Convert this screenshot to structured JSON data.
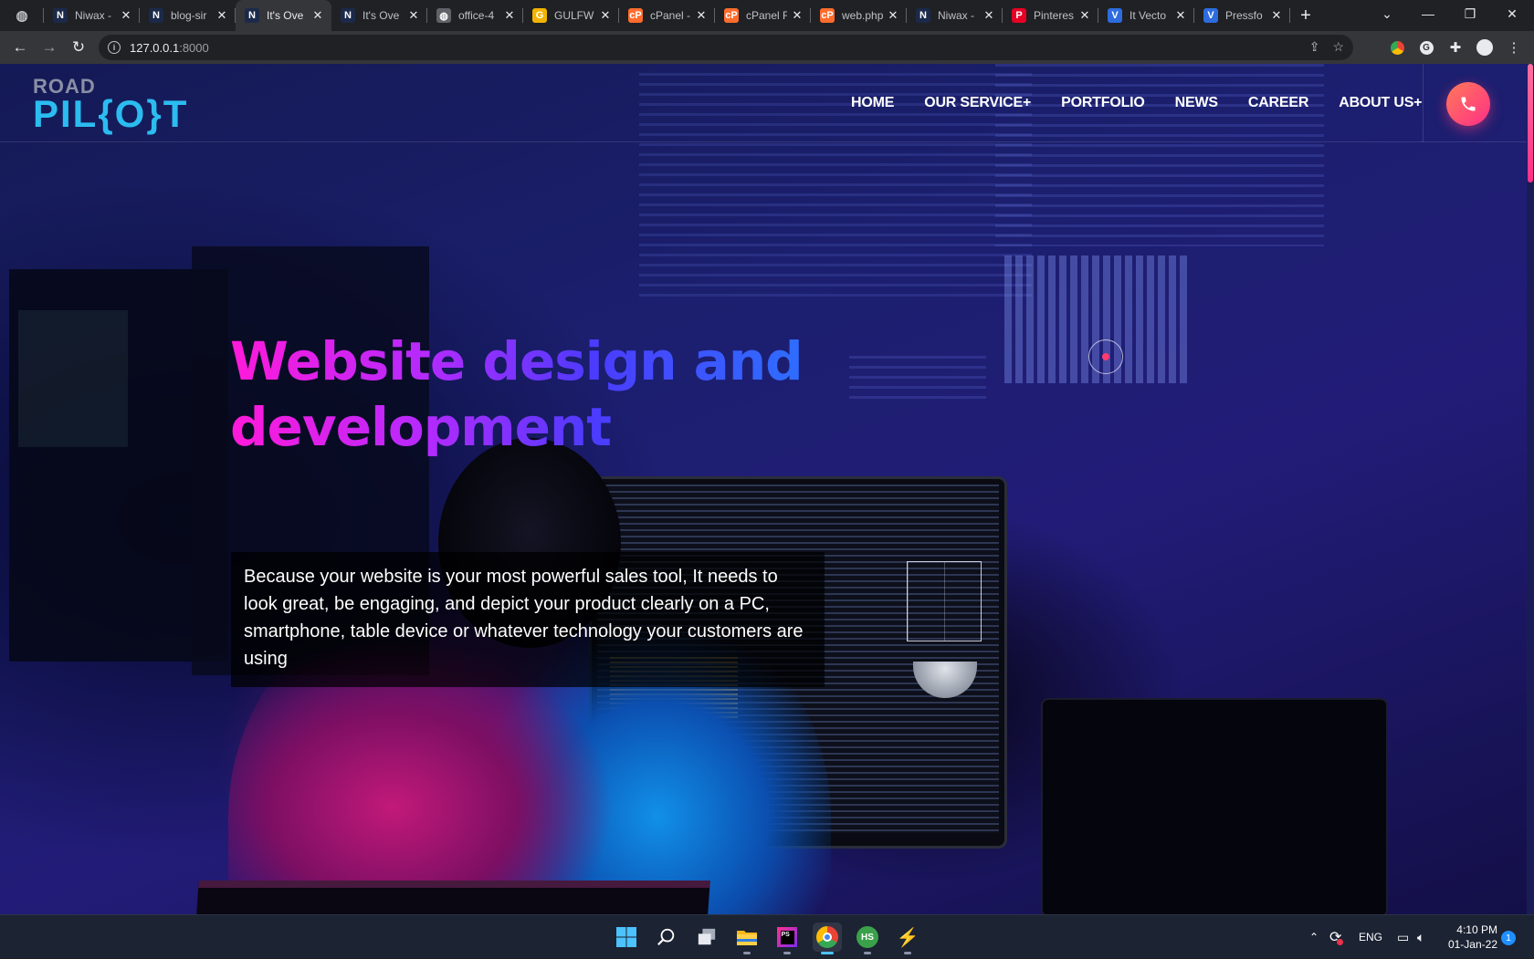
{
  "browser": {
    "tabs": [
      {
        "title": "",
        "favicon": "globe-icon",
        "fav_color": "#5f6368",
        "fav_glyph": "◍"
      },
      {
        "title": "Niwax -",
        "favicon": "n-logo-icon",
        "fav_color": "#1b2a4a",
        "fav_glyph": "N"
      },
      {
        "title": "blog-sir",
        "favicon": "n-logo-icon",
        "fav_color": "#1b2a4a",
        "fav_glyph": "N"
      },
      {
        "title": "It's Ove",
        "favicon": "n-logo-icon",
        "fav_color": "#1b2a4a",
        "fav_glyph": "N",
        "active": true
      },
      {
        "title": "It's Ove",
        "favicon": "n-logo-icon",
        "fav_color": "#1b2a4a",
        "fav_glyph": "N"
      },
      {
        "title": "office-4",
        "favicon": "globe-icon",
        "fav_color": "#5f6368",
        "fav_glyph": "◍"
      },
      {
        "title": "GULFW",
        "favicon": "gulf-logo-icon",
        "fav_color": "#f2b400",
        "fav_glyph": "G"
      },
      {
        "title": "cPanel -",
        "favicon": "cpanel-icon",
        "fav_color": "#ff6c2c",
        "fav_glyph": "cP"
      },
      {
        "title": "cPanel F",
        "favicon": "cpanel-icon",
        "fav_color": "#ff6c2c",
        "fav_glyph": "cP"
      },
      {
        "title": "web.php",
        "favicon": "cpanel-icon",
        "fav_color": "#ff6c2c",
        "fav_glyph": "cP"
      },
      {
        "title": "Niwax -",
        "favicon": "n-logo-icon",
        "fav_color": "#1b2a4a",
        "fav_glyph": "N"
      },
      {
        "title": "Pinteres",
        "favicon": "pinterest-icon",
        "fav_color": "#e60023",
        "fav_glyph": "P"
      },
      {
        "title": "It Vecto",
        "favicon": "vector-logo-icon",
        "fav_color": "#2d6cdf",
        "fav_glyph": "V"
      },
      {
        "title": "Pressfo",
        "favicon": "vector-logo-icon",
        "fav_color": "#2d6cdf",
        "fav_glyph": "V"
      }
    ],
    "close_glyph": "✕",
    "new_tab_glyph": "+",
    "url_host": "127.0.0.1",
    "url_port": ":8000"
  },
  "site": {
    "logo_top": "ROAD",
    "logo_main": "PIL{O}T",
    "nav": [
      "HOME",
      "OUR SERVICE+",
      "PORTFOLIO",
      "NEWS",
      "CAREER",
      "ABOUT US+"
    ],
    "hero_title": "Website design and development",
    "hero_description": "Because your website is your most powerful sales tool, It needs to look great, be engaging, and depict your product clearly on a PC, smartphone, table device or whatever technology your customers are using",
    "accent_color": "#ff2f86"
  },
  "taskbar": {
    "language": "ENG",
    "time": "4:10 PM",
    "date": "01-Jan-22",
    "notification_count": "1"
  }
}
